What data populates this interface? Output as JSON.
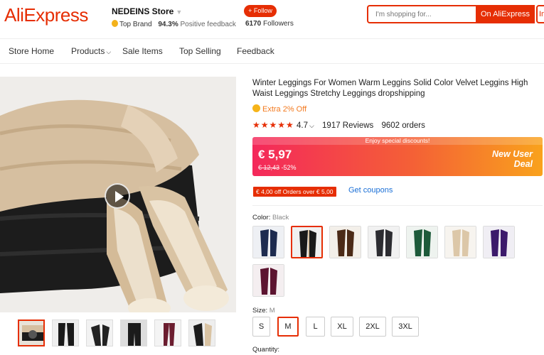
{
  "header": {
    "logo": "AliExpress",
    "store_name": "NEDEINS Store",
    "badge": "Top Brand",
    "feedback_pct": "94.3%",
    "feedback_label": "Positive feedback",
    "follow_label": "+ Follow",
    "followers_count": "6170",
    "followers_label": "Followers",
    "search_placeholder": "I'm shopping for...",
    "search_button": "On AliExpress",
    "search_button_2": "In this store"
  },
  "nav": {
    "items": [
      "Store Home",
      "Products",
      "Sale Items",
      "Top Selling",
      "Feedback"
    ]
  },
  "product": {
    "title": "Winter Leggings For Women Warm Leggins Solid Color Velvet Leggins High Waist Leggings Stretchy Leggings dropshipping",
    "extra_off": "Extra 2% Off",
    "stars": "★★★★★",
    "rating": "4.7",
    "reviews": "1917 Reviews",
    "orders": "9602 orders",
    "discount_strip": "Enjoy special discounts!",
    "price": "€ 5,97",
    "old_price": "€ 12,43",
    "discount_pct": "-52%",
    "deal_line1": "New User",
    "deal_line2": "Deal",
    "coupon_tag": "€ 4,00 off Orders over € 5,00",
    "get_coupons": "Get coupons"
  },
  "options": {
    "color_label": "Color:",
    "color_value": "Black",
    "colors": [
      "navy",
      "black",
      "brown",
      "dark gray",
      "green",
      "beige",
      "purple",
      "burgundy"
    ],
    "selected_color_index": 1,
    "size_label": "Size:",
    "size_value": "M",
    "sizes": [
      "S",
      "M",
      "L",
      "XL",
      "2XL",
      "3XL"
    ],
    "selected_size_index": 1,
    "quantity_label": "Quantity:"
  },
  "colors": {
    "accent": "#e62e04",
    "banner_start": "#f4285b",
    "banner_end": "#f9a21c",
    "link": "#1a6fd6",
    "extra": "#f37a1f"
  }
}
